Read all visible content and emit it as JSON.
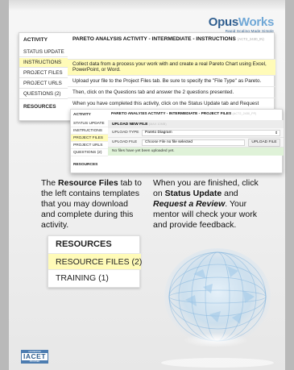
{
  "brand": {
    "name_part1": "Opus",
    "name_part2": "Works",
    "tagline": "Rapid Scaling Made Simple",
    "colors": {
      "dark_blue": "#2f5e8f",
      "light_blue": "#6fa7d6",
      "highlight": "#fffbb8",
      "success_bg": "#dff2d8"
    }
  },
  "panel1": {
    "sidebar": {
      "header": "ACTIVITY",
      "items": [
        "STATUS UPDATE",
        "INSTRUCTIONS",
        "PROJECT FILES",
        "PROJECT URLS",
        "QUESTIONS (2)"
      ],
      "selected": "INSTRUCTIONS",
      "resources_label": "RESOURCES"
    },
    "title": "PARETO ANALYSIS ACTIVITY - INTERMEDIATE - INSTRUCTIONS",
    "title_suffix": "(ACT2_2430_IN)",
    "instructions": [
      "Collect data from a process your work with and create a real Pareto Chart using Excel, PowerPoint, or Word.",
      "Upload your file to the Project Files tab. Be sure to specify the \"File Type\" as Pareto.",
      "Then, click on the Questions tab and answer the 2 questions presented.",
      "When you have completed this activity, click on the Status Update tab and Request"
    ]
  },
  "panel2": {
    "sidebar": {
      "header": "ACTIVITY",
      "items": [
        "STATUS UPDATE",
        "INSTRUCTIONS",
        "PROJECT FILES",
        "PROJECT URLS",
        "QUESTIONS (2)"
      ],
      "selected": "PROJECT FILES",
      "resources_label": "RESOURCES"
    },
    "title": "PARETO ANALYSIS ACTIVITY - INTERMEDIATE - PROJECT FILES",
    "title_suffix": "(ACT2_2430_PF)",
    "upload_header": "UPLOAD NEW FILE",
    "upload_header_suffix": "(MAX 10MB)",
    "upload_type_label": "UPLOAD TYPE",
    "upload_type_value": "Pareto Diagram",
    "upload_file_label": "UPLOAD FILE",
    "choose_file_label": "Choose File",
    "no_file_selected": "no file selected",
    "upload_button": "UPLOAD FILE",
    "no_files_message": "No files have yet been uploaded yet."
  },
  "explain_left": {
    "line1_pre": "The ",
    "line1_bold": "Resource Files",
    "line1_post": " tab to the left contains templates that you may download and complete during this activity."
  },
  "explain_right": {
    "pre": "When you are finished, click on ",
    "bold1": "Status Update",
    "mid": " and ",
    "italic_bold": "Request a Review",
    "post": ". Your mentor will check your work and provide feedback."
  },
  "resources_box": {
    "header": "RESOURCES",
    "items": [
      "RESOURCE FILES (2)",
      "TRAINING (1)"
    ],
    "selected": "RESOURCE FILES (2)"
  },
  "badge": {
    "top": "ACCREDITED",
    "main": "IACET",
    "bottom": "PROVIDER"
  }
}
